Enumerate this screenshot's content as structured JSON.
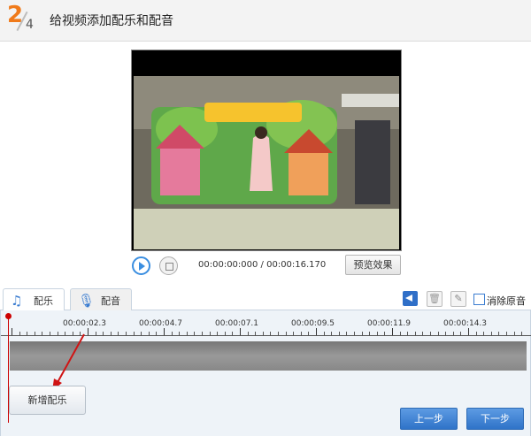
{
  "header": {
    "step_current": "2",
    "step_total": "4",
    "title": "给视频添加配乐和配音"
  },
  "player": {
    "timecode": "00:00:00:000 / 00:00:16.170",
    "preview_label": "预览效果",
    "play_icon": "play-icon",
    "stop_icon": "stop-icon"
  },
  "tabs": [
    {
      "label": "配乐",
      "icon": "music-note-icon",
      "active": true
    },
    {
      "label": "配音",
      "icon": "microphone-icon",
      "active": false
    }
  ],
  "toolbar": {
    "mute_label": "消除原音",
    "mute_checked": false
  },
  "timeline": {
    "tick_labels": [
      "00:00:02.3",
      "00:00:04.7",
      "00:00:07.1",
      "00:00:09.5",
      "00:00:11.9",
      "00:00:14.3"
    ]
  },
  "buttons": {
    "add_music": "新增配乐",
    "prev": "上一步",
    "next": "下一步"
  },
  "colors": {
    "accent_orange": "#f07a1a",
    "primary_blue": "#2f73c8",
    "playhead_red": "#cc0000"
  }
}
